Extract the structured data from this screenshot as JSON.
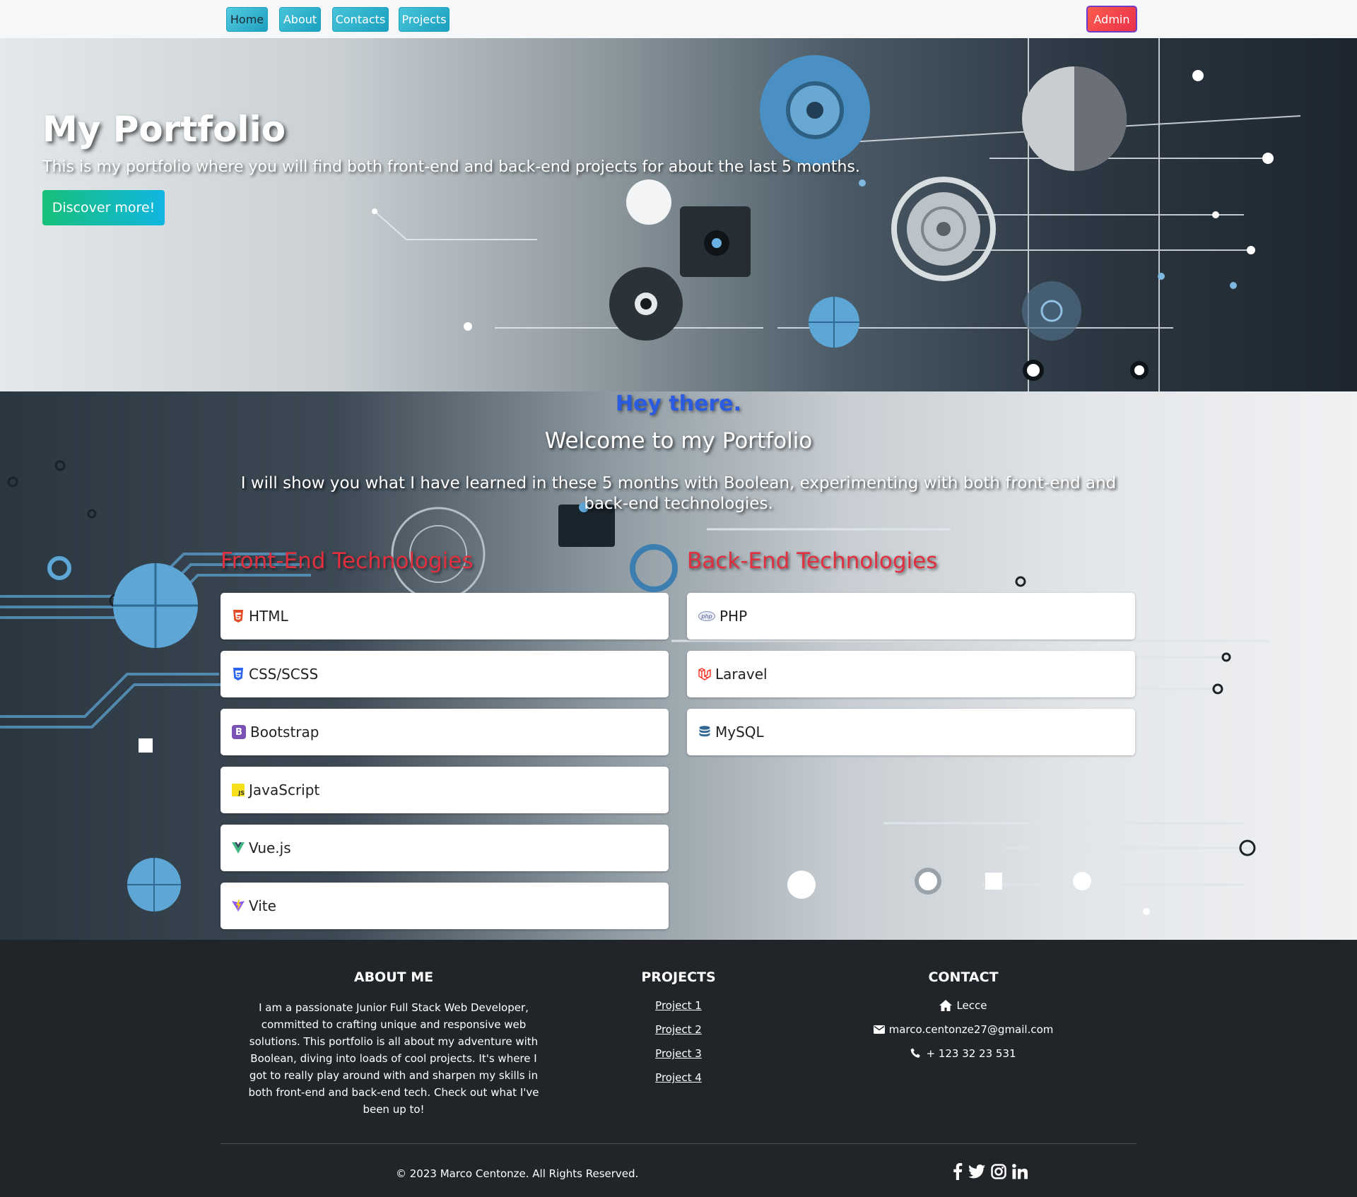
{
  "nav": {
    "items": [
      {
        "label": "Home"
      },
      {
        "label": "About"
      },
      {
        "label": "Contacts"
      },
      {
        "label": "Projects"
      }
    ],
    "admin_label": "Admin"
  },
  "hero": {
    "title": "My Portfolio",
    "subtitle": "This is my portfolio where you will find both front-end and back-end projects for about the last 5 months.",
    "button_label": "Discover more!"
  },
  "main": {
    "greeting": "Hey there.",
    "welcome": "Welcome to my Portfolio",
    "intro": "I will show you what I have learned in these 5 months with Boolean, experimenting with both front-end and back-end technologies.",
    "front_title": "Front-End Technologies",
    "back_title": "Back-End Technologies",
    "front": [
      {
        "label": "HTML",
        "icon": "html5-icon",
        "color": "#e34c26"
      },
      {
        "label": "CSS/SCSS",
        "icon": "css3-icon",
        "color": "#2965f1"
      },
      {
        "label": "Bootstrap",
        "icon": "bootstrap-icon",
        "color": "#7952b3"
      },
      {
        "label": "JavaScript",
        "icon": "javascript-icon",
        "color": "#f7df1e"
      },
      {
        "label": "Vue.js",
        "icon": "vue-icon",
        "color": "#42b883"
      },
      {
        "label": "Vite",
        "icon": "vite-icon",
        "color": "#a855f7"
      }
    ],
    "back": [
      {
        "label": "PHP",
        "icon": "php-icon",
        "color": "#8892bf"
      },
      {
        "label": "Laravel",
        "icon": "laravel-icon",
        "color": "#ff2d20"
      },
      {
        "label": "MySQL",
        "icon": "database-icon",
        "color": "#336791"
      }
    ]
  },
  "footer": {
    "about_title": "ABOUT ME",
    "about_text": "I am a passionate Junior Full Stack Web Developer, committed to crafting unique and responsive web solutions. This portfolio is all about my adventure with Boolean, diving into loads of cool projects. It's where I got to really play around with and sharpen my skills in both front-end and back-end tech. Check out what I've been up to!",
    "projects_title": "PROJECTS",
    "projects": [
      "Project 1",
      "Project 2",
      "Project 3",
      "Project 4"
    ],
    "contact_title": "CONTACT",
    "city": "Lecce",
    "email": "marco.centonze27@gmail.com",
    "phone": "+ 123 32 23 531",
    "copyright": "© 2023 Marco Centonze. All Rights Reserved.",
    "socials": [
      "facebook-icon",
      "twitter-icon",
      "instagram-icon",
      "linkedin-icon"
    ]
  }
}
